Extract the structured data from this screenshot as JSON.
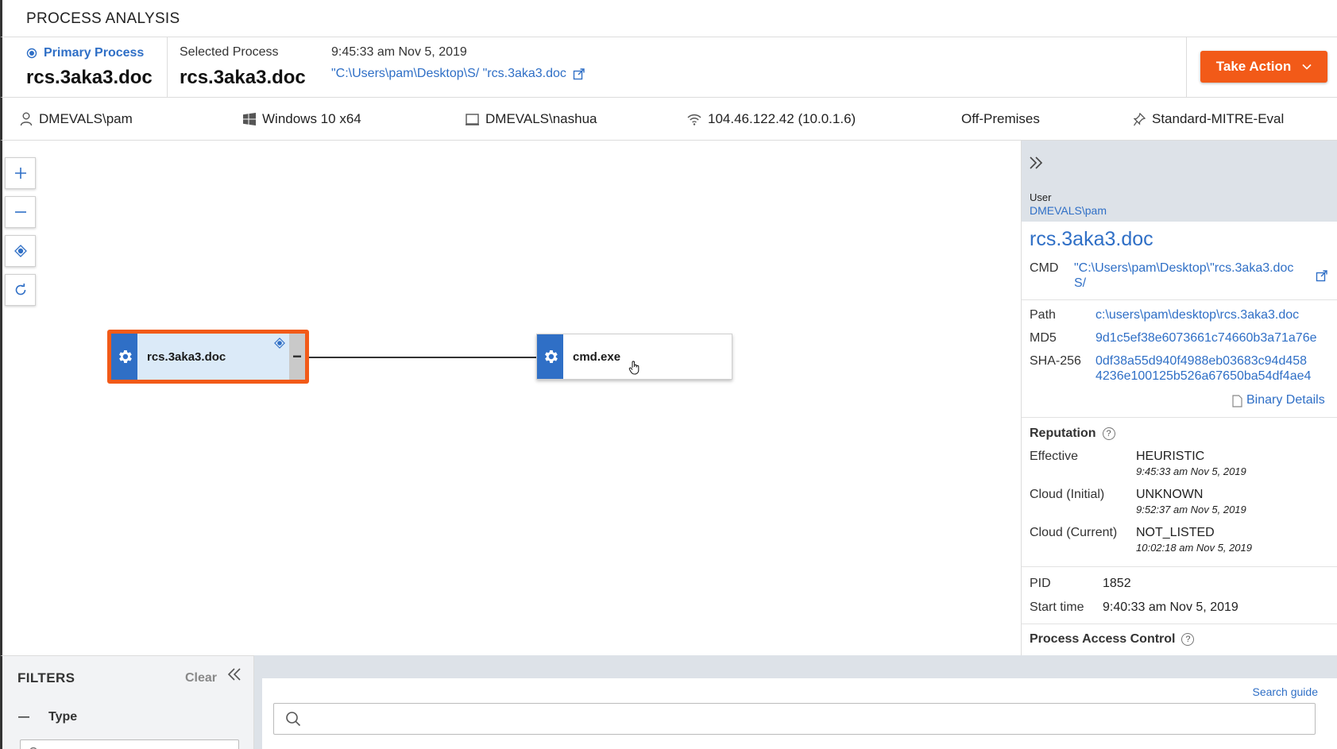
{
  "header": {
    "title": "PROCESS ANALYSIS"
  },
  "primary_process": {
    "label": "Primary Process",
    "name": "rcs.3aka3.doc"
  },
  "selected_process": {
    "label": "Selected Process",
    "name": "rcs.3aka3.doc",
    "time": "9:45:33 am Nov 5, 2019",
    "path": "\"C:\\Users\\pam\\Desktop\\S/ \"rcs.3aka3.doc"
  },
  "actions": {
    "take_action_label": "Take Action"
  },
  "info": {
    "user": "DMEVALS\\pam",
    "os": "Windows 10 x64",
    "device": "DMEVALS\\nashua",
    "ip": "104.46.122.42 (10.0.1.6)",
    "location": "Off-Premises",
    "policy": "Standard-MITRE-Eval"
  },
  "colors": {
    "accent": "#2f6fc6",
    "action": "#f25a18"
  },
  "graph": {
    "nodes": [
      {
        "label": "rcs.3aka3.doc",
        "selected": true
      },
      {
        "label": "cmd.exe",
        "selected": false
      }
    ]
  },
  "details": {
    "user_label": "User",
    "user_value": "DMEVALS\\pam",
    "process_name": "rcs.3aka3.doc",
    "cmd_label": "CMD",
    "cmd_line1": "\"C:\\Users\\pam\\Desktop\\\"rcs.3aka3.doc",
    "cmd_line2": "S/",
    "path_label": "Path",
    "path_value": "c:\\users\\pam\\desktop\\rcs.3aka3.doc",
    "md5_label": "MD5",
    "md5_value": "9d1c5ef38e6073661c74660b3a71a76e",
    "sha_label": "SHA-256",
    "sha_line1": "0df38a55d940f4988eb03683c94d458",
    "sha_line2": "4236e100125b526a67650ba54df4ae4",
    "binary_details_label": "Binary Details",
    "reputation_title": "Reputation",
    "reputation": [
      {
        "label": "Effective",
        "value": "HEURISTIC",
        "time": "9:45:33 am Nov 5, 2019"
      },
      {
        "label": "Cloud (Initial)",
        "value": "UNKNOWN",
        "time": "9:52:37 am Nov 5, 2019"
      },
      {
        "label": "Cloud (Current)",
        "value": "NOT_LISTED",
        "time": "10:02:18 am Nov 5, 2019"
      }
    ],
    "pid_label": "PID",
    "pid_value": "1852",
    "start_label": "Start time",
    "start_value": "9:40:33 am Nov 5, 2019",
    "pac_title": "Process Access Control"
  },
  "filters": {
    "title": "FILTERS",
    "clear_label": "Clear",
    "type_label": "Type",
    "search_placeholder": "Search"
  },
  "search": {
    "guide_label": "Search guide"
  }
}
